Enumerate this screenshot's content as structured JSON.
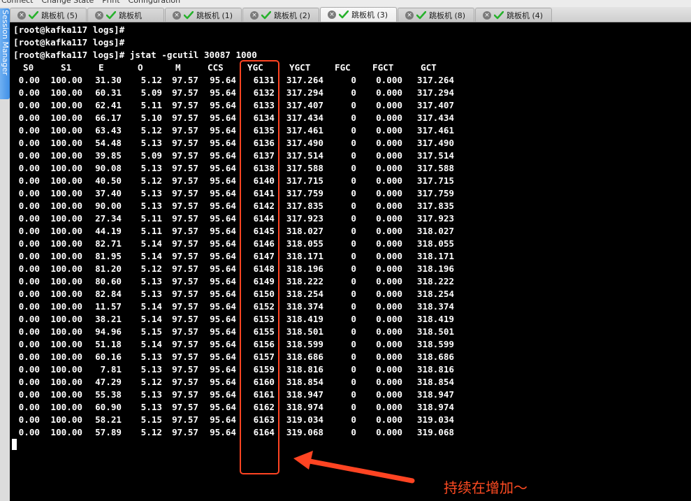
{
  "menu": [
    "Connect",
    "Change State",
    "Print",
    "Configuration"
  ],
  "tabs": [
    {
      "label": "跳板机 (5)"
    },
    {
      "label": "跳板机"
    },
    {
      "label": "跳板机 (1)"
    },
    {
      "label": "跳板机 (2)"
    },
    {
      "label": "跳板机 (3)",
      "active": true
    },
    {
      "label": "跳板机 (8)"
    },
    {
      "label": "跳板机 (4)"
    }
  ],
  "session_manager_label": "Session Manager",
  "terminal": {
    "prompts": [
      "[root@kafka117 logs]#",
      "[root@kafka117 logs]#",
      "[root@kafka117 logs]# jstat -gcutil 30087 1000"
    ],
    "columns": [
      "S0",
      "S1",
      "E",
      "O",
      "M",
      "CCS",
      "YGC",
      "YGCT",
      "FGC",
      "FGCT",
      "GCT"
    ],
    "rows": [
      [
        "0.00",
        "100.00",
        "31.30",
        "5.12",
        "97.57",
        "95.64",
        "6131",
        "317.264",
        "0",
        "0.000",
        "317.264"
      ],
      [
        "0.00",
        "100.00",
        "60.31",
        "5.09",
        "97.57",
        "95.64",
        "6132",
        "317.294",
        "0",
        "0.000",
        "317.294"
      ],
      [
        "0.00",
        "100.00",
        "62.41",
        "5.11",
        "97.57",
        "95.64",
        "6133",
        "317.407",
        "0",
        "0.000",
        "317.407"
      ],
      [
        "0.00",
        "100.00",
        "66.17",
        "5.10",
        "97.57",
        "95.64",
        "6134",
        "317.434",
        "0",
        "0.000",
        "317.434"
      ],
      [
        "0.00",
        "100.00",
        "63.43",
        "5.12",
        "97.57",
        "95.64",
        "6135",
        "317.461",
        "0",
        "0.000",
        "317.461"
      ],
      [
        "0.00",
        "100.00",
        "54.48",
        "5.13",
        "97.57",
        "95.64",
        "6136",
        "317.490",
        "0",
        "0.000",
        "317.490"
      ],
      [
        "0.00",
        "100.00",
        "39.85",
        "5.09",
        "97.57",
        "95.64",
        "6137",
        "317.514",
        "0",
        "0.000",
        "317.514"
      ],
      [
        "0.00",
        "100.00",
        "90.08",
        "5.13",
        "97.57",
        "95.64",
        "6138",
        "317.588",
        "0",
        "0.000",
        "317.588"
      ],
      [
        "0.00",
        "100.00",
        "40.50",
        "5.12",
        "97.57",
        "95.64",
        "6140",
        "317.715",
        "0",
        "0.000",
        "317.715"
      ],
      [
        "0.00",
        "100.00",
        "37.40",
        "5.13",
        "97.57",
        "95.64",
        "6141",
        "317.759",
        "0",
        "0.000",
        "317.759"
      ],
      [
        "0.00",
        "100.00",
        "90.00",
        "5.13",
        "97.57",
        "95.64",
        "6142",
        "317.835",
        "0",
        "0.000",
        "317.835"
      ],
      [
        "0.00",
        "100.00",
        "27.34",
        "5.11",
        "97.57",
        "95.64",
        "6144",
        "317.923",
        "0",
        "0.000",
        "317.923"
      ],
      [
        "0.00",
        "100.00",
        "44.19",
        "5.11",
        "97.57",
        "95.64",
        "6145",
        "318.027",
        "0",
        "0.000",
        "318.027"
      ],
      [
        "0.00",
        "100.00",
        "82.71",
        "5.14",
        "97.57",
        "95.64",
        "6146",
        "318.055",
        "0",
        "0.000",
        "318.055"
      ],
      [
        "0.00",
        "100.00",
        "81.95",
        "5.14",
        "97.57",
        "95.64",
        "6147",
        "318.171",
        "0",
        "0.000",
        "318.171"
      ],
      [
        "0.00",
        "100.00",
        "81.20",
        "5.12",
        "97.57",
        "95.64",
        "6148",
        "318.196",
        "0",
        "0.000",
        "318.196"
      ],
      [
        "0.00",
        "100.00",
        "80.60",
        "5.13",
        "97.57",
        "95.64",
        "6149",
        "318.222",
        "0",
        "0.000",
        "318.222"
      ],
      [
        "0.00",
        "100.00",
        "82.84",
        "5.13",
        "97.57",
        "95.64",
        "6150",
        "318.254",
        "0",
        "0.000",
        "318.254"
      ],
      [
        "0.00",
        "100.00",
        "11.57",
        "5.14",
        "97.57",
        "95.64",
        "6152",
        "318.374",
        "0",
        "0.000",
        "318.374"
      ],
      [
        "0.00",
        "100.00",
        "38.21",
        "5.14",
        "97.57",
        "95.64",
        "6153",
        "318.419",
        "0",
        "0.000",
        "318.419"
      ],
      [
        "0.00",
        "100.00",
        "94.96",
        "5.15",
        "97.57",
        "95.64",
        "6155",
        "318.501",
        "0",
        "0.000",
        "318.501"
      ],
      [
        "0.00",
        "100.00",
        "51.18",
        "5.14",
        "97.57",
        "95.64",
        "6156",
        "318.599",
        "0",
        "0.000",
        "318.599"
      ],
      [
        "0.00",
        "100.00",
        "60.16",
        "5.13",
        "97.57",
        "95.64",
        "6157",
        "318.686",
        "0",
        "0.000",
        "318.686"
      ],
      [
        "0.00",
        "100.00",
        "7.81",
        "5.13",
        "97.57",
        "95.64",
        "6159",
        "318.816",
        "0",
        "0.000",
        "318.816"
      ],
      [
        "0.00",
        "100.00",
        "47.29",
        "5.12",
        "97.57",
        "95.64",
        "6160",
        "318.854",
        "0",
        "0.000",
        "318.854"
      ],
      [
        "0.00",
        "100.00",
        "55.38",
        "5.13",
        "97.57",
        "95.64",
        "6161",
        "318.947",
        "0",
        "0.000",
        "318.947"
      ],
      [
        "0.00",
        "100.00",
        "60.90",
        "5.13",
        "97.57",
        "95.64",
        "6162",
        "318.974",
        "0",
        "0.000",
        "318.974"
      ],
      [
        "0.00",
        "100.00",
        "58.21",
        "5.15",
        "97.57",
        "95.64",
        "6163",
        "319.034",
        "0",
        "0.000",
        "319.034"
      ],
      [
        "0.00",
        "100.00",
        "57.89",
        "5.12",
        "97.57",
        "95.64",
        "6164",
        "319.068",
        "0",
        "0.000",
        "319.068"
      ]
    ]
  },
  "annotation": {
    "text": "持续在增加～",
    "color": "#ff4b22"
  },
  "colors": {
    "terminal_bg": "#000000",
    "terminal_fg": "#ffffff",
    "tab_check": "#27b12c",
    "annotation": "#ff4422"
  }
}
